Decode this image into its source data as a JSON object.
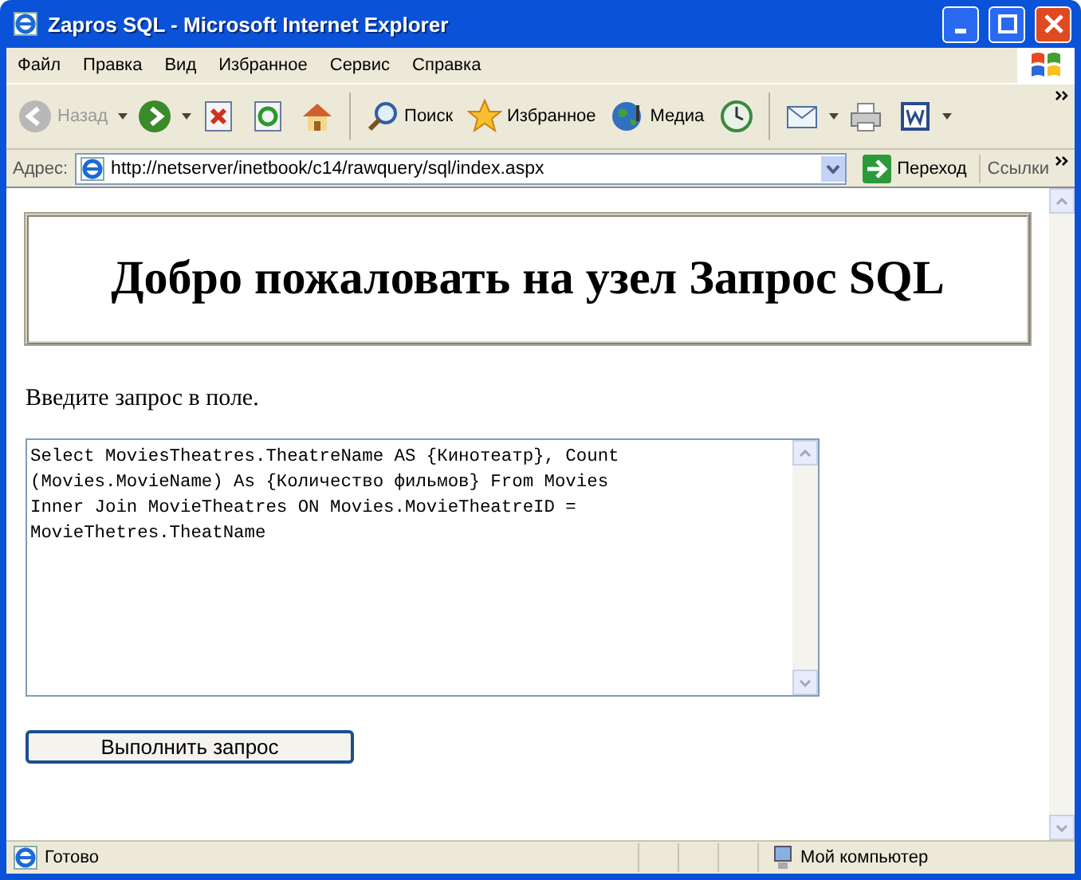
{
  "window": {
    "title": "Zapros SQL - Microsoft Internet Explorer"
  },
  "menu": [
    "Файл",
    "Правка",
    "Вид",
    "Избранное",
    "Сервис",
    "Справка"
  ],
  "toolbar": [
    {
      "kind": "back",
      "label": "Назад",
      "disabled": true
    },
    {
      "kind": "forward",
      "disabled": false
    },
    {
      "kind": "stop"
    },
    {
      "kind": "refresh"
    },
    {
      "kind": "home"
    },
    {
      "kind": "search",
      "label": "Поиск"
    },
    {
      "kind": "favorites",
      "label": "Избранное"
    },
    {
      "kind": "media",
      "label": "Медиа"
    },
    {
      "kind": "history"
    },
    {
      "kind": "mail"
    },
    {
      "kind": "print"
    },
    {
      "kind": "word"
    }
  ],
  "address": {
    "label": "Адрес:",
    "value": "http://netserver/inetbook/c14/rawquery/sql/index.aspx",
    "go": "Переход",
    "links": "Ссылки"
  },
  "page": {
    "heading": "Добро пожаловать на узел Запрос SQL",
    "prompt": "Введите запрос в поле.",
    "query": "Select MoviesTheatres.TheatreName AS {Кинотеатр}, Count\n(Movies.MovieName) As {Количество фильмов} From Movies\nInner Join MovieTheatres ON Movies.MovieTheatreID =\nMovieThetres.TheatName",
    "button": "Выполнить запрос"
  },
  "status_bar": {
    "text": "Готово",
    "zone": "Мой компьютер"
  }
}
